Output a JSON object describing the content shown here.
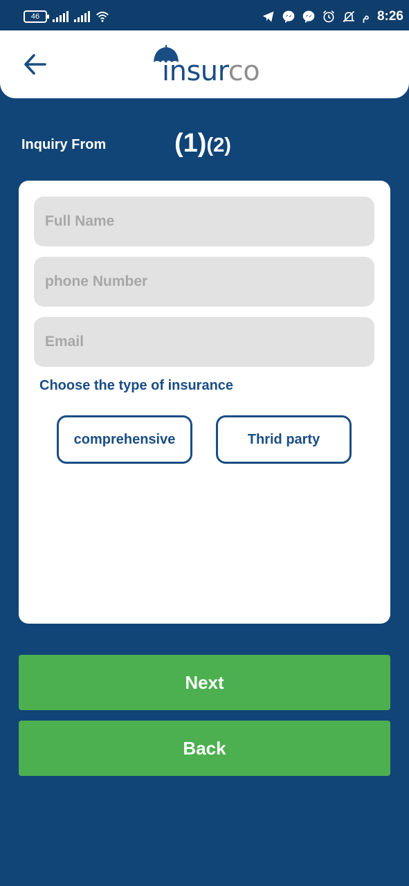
{
  "status_bar": {
    "battery": "46",
    "time": "8:26",
    "ampm": "م",
    "icons": [
      "battery-icon",
      "signal-icon",
      "signal-icon",
      "wifi-icon",
      "telegram-icon",
      "messenger-icon",
      "messenger-icon",
      "alarm-icon",
      "mute-icon"
    ]
  },
  "app_bar": {
    "logo_part1": "insur",
    "logo_part2": "co",
    "back_icon": "arrow-left-icon"
  },
  "form": {
    "title": "Inquiry From",
    "step_current": "(1)",
    "step_next": "(2)",
    "fields": {
      "full_name_placeholder": "Full Name",
      "phone_placeholder": "phone Number",
      "email_placeholder": "Email"
    },
    "choose_label": "Choose the type of insurance",
    "options": [
      "comprehensive",
      "Thrid party"
    ]
  },
  "buttons": {
    "next": "Next",
    "back": "Back"
  },
  "colors": {
    "background": "#114477",
    "primary": "#1a4d84",
    "button_green": "#4caf50",
    "input_bg": "#e2e2e2"
  }
}
